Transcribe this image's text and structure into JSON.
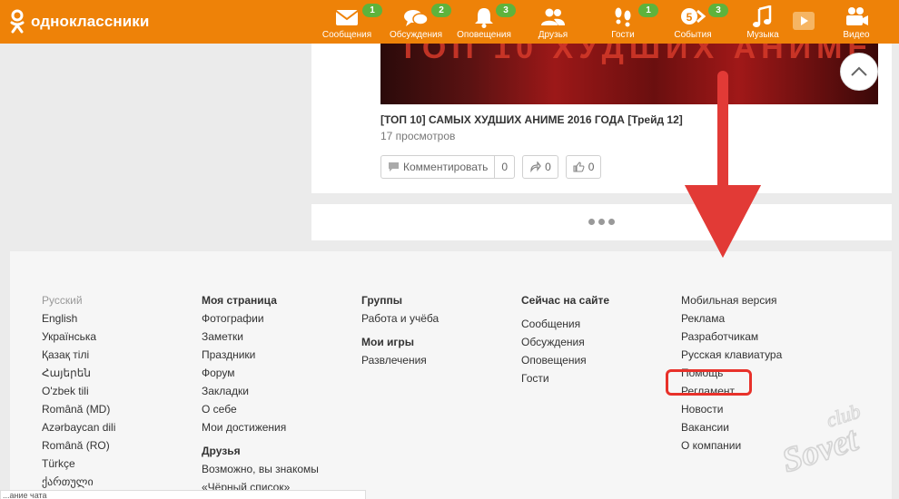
{
  "topbar": {
    "logo_text": "одноклассники",
    "items": [
      {
        "label": "Сообщения",
        "badge": "1"
      },
      {
        "label": "Обсуждения",
        "badge": "2"
      },
      {
        "label": "Оповещения",
        "badge": "3"
      },
      {
        "label": "Друзья",
        "badge": ""
      },
      {
        "label": "Гости",
        "badge": "1"
      },
      {
        "label": "События",
        "badge": "3",
        "icon_text": "5"
      },
      {
        "label": "Музыка",
        "badge": ""
      },
      {
        "label": "Видео",
        "badge": ""
      }
    ]
  },
  "feed": {
    "thumb_text": "ТОП 10 ХУДШИХ АНИМЕ",
    "video_title": "[ТОП 10] САМЫХ ХУДШИХ АНИМЕ 2016 ГОДА [Трейд 12]",
    "views": "17 просмотров",
    "comment_label": "Комментировать",
    "comment_count": "0",
    "share_count": "0",
    "like_count": "0"
  },
  "footer": {
    "languages": [
      "Русский",
      "English",
      "Українська",
      "Қазақ тілі",
      "Հայերեն",
      "O'zbek tili",
      "Română (MD)",
      "Azərbaycan dili",
      "Română (RO)",
      "Türkçe",
      "ქართული"
    ],
    "col2": {
      "heading1": "Моя страница",
      "links1": [
        "Фотографии",
        "Заметки",
        "Праздники",
        "Форум",
        "Закладки",
        "О себе",
        "Мои достижения"
      ],
      "heading2": "Друзья",
      "links2": [
        "Возможно, вы знакомы",
        "«Чёрный список»"
      ]
    },
    "col3": {
      "heading1": "Группы",
      "links1": [
        "Работа и учёба"
      ],
      "heading2": "Мои игры",
      "links2": [
        "Развлечения"
      ]
    },
    "col4": {
      "heading": "Сейчас на сайте",
      "links": [
        "Сообщения",
        "Обсуждения",
        "Оповещения",
        "Гости"
      ]
    },
    "col5": {
      "links": [
        "Мобильная версия",
        "Реклама",
        "Разработчикам",
        "Русская клавиатура",
        "Помощь",
        "Регламент",
        "Новости",
        "Вакансии",
        "О компании"
      ]
    }
  },
  "watermark": {
    "line1": "club",
    "line2": "Sovet"
  },
  "bottom_bar_text": "...ание чата"
}
